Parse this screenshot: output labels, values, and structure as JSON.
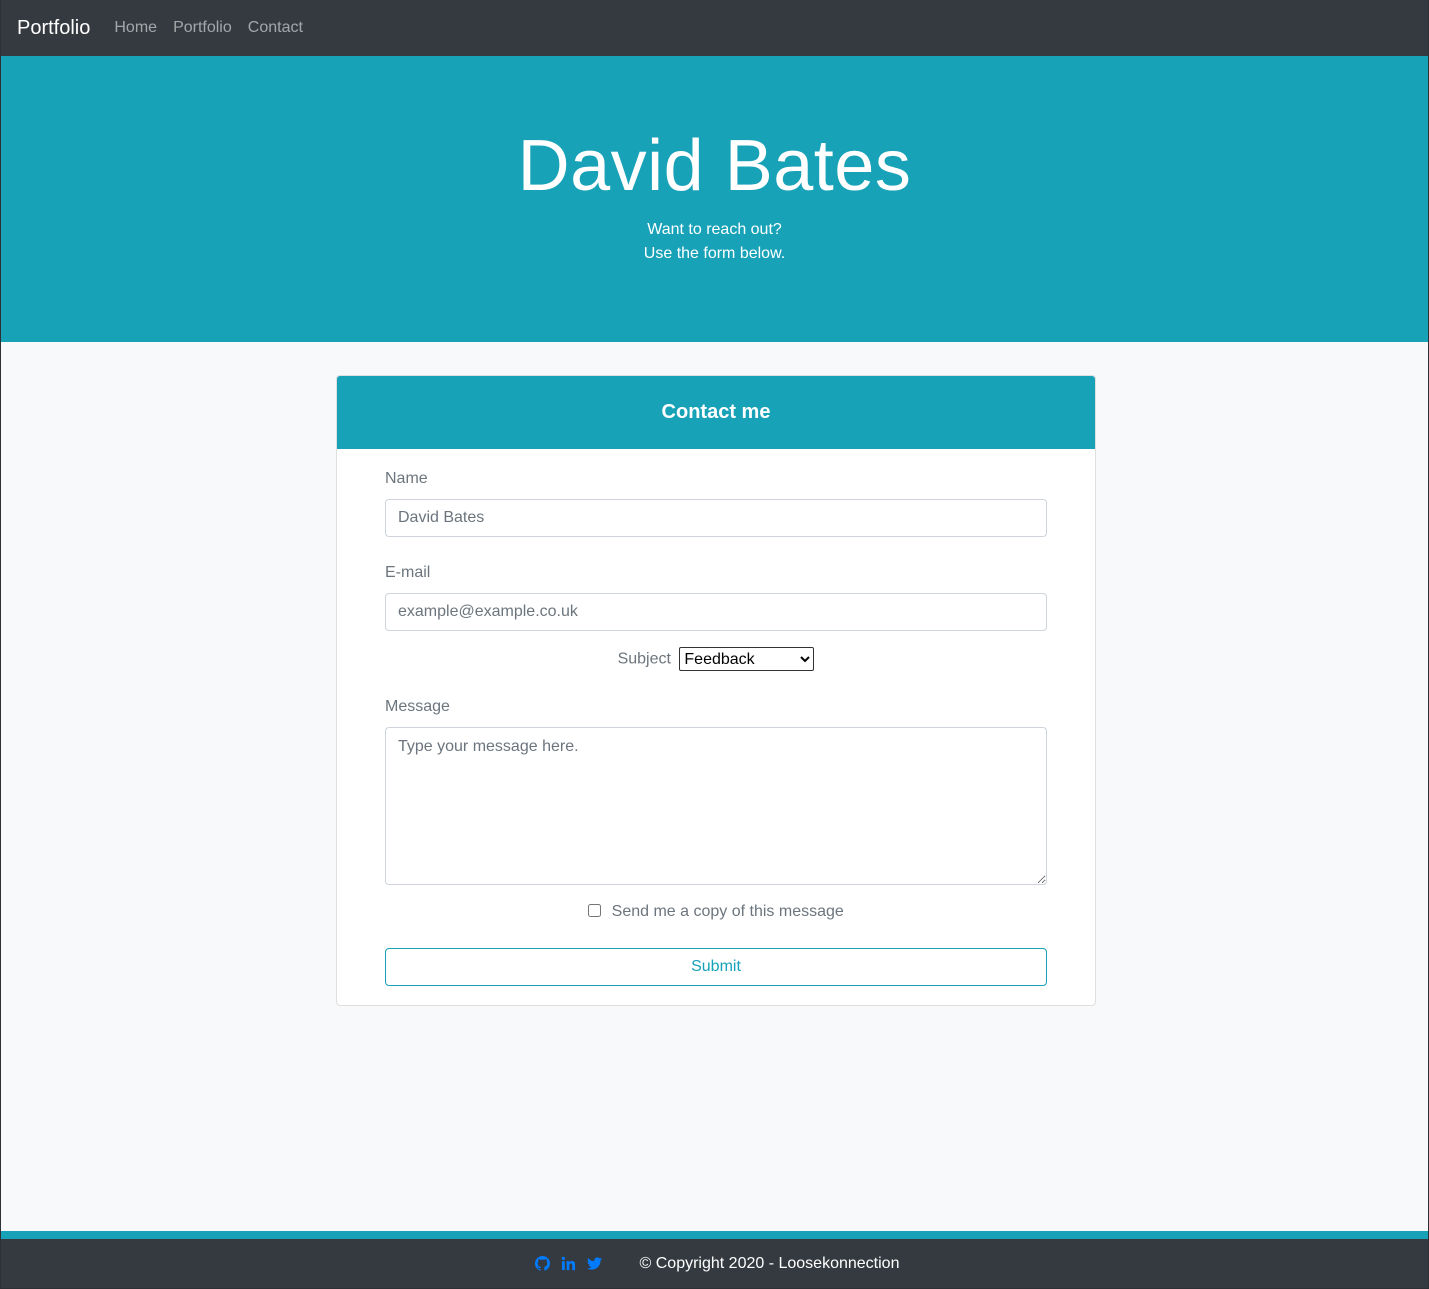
{
  "navbar": {
    "brand": "Portfolio",
    "links": [
      "Home",
      "Portfolio",
      "Contact"
    ]
  },
  "hero": {
    "title": "David Bates",
    "line1": "Want to reach out?",
    "line2": "Use the form below."
  },
  "form": {
    "header": "Contact me",
    "name_label": "Name",
    "name_placeholder": "David Bates",
    "email_label": "E-mail",
    "email_placeholder": "example@example.co.uk",
    "subject_label": "Subject",
    "subject_selected": "Feedback",
    "message_label": "Message",
    "message_placeholder": "Type your message here.",
    "copy_label": "Send me a copy of this message",
    "submit_label": "Submit"
  },
  "footer": {
    "icons": [
      "github-icon",
      "linkedin-icon",
      "twitter-icon"
    ],
    "copyright": "© Copyright 2020 - Loosekonnection"
  },
  "colors": {
    "accent": "#17a2b8",
    "dark": "#343a40",
    "social": "#007bff"
  }
}
